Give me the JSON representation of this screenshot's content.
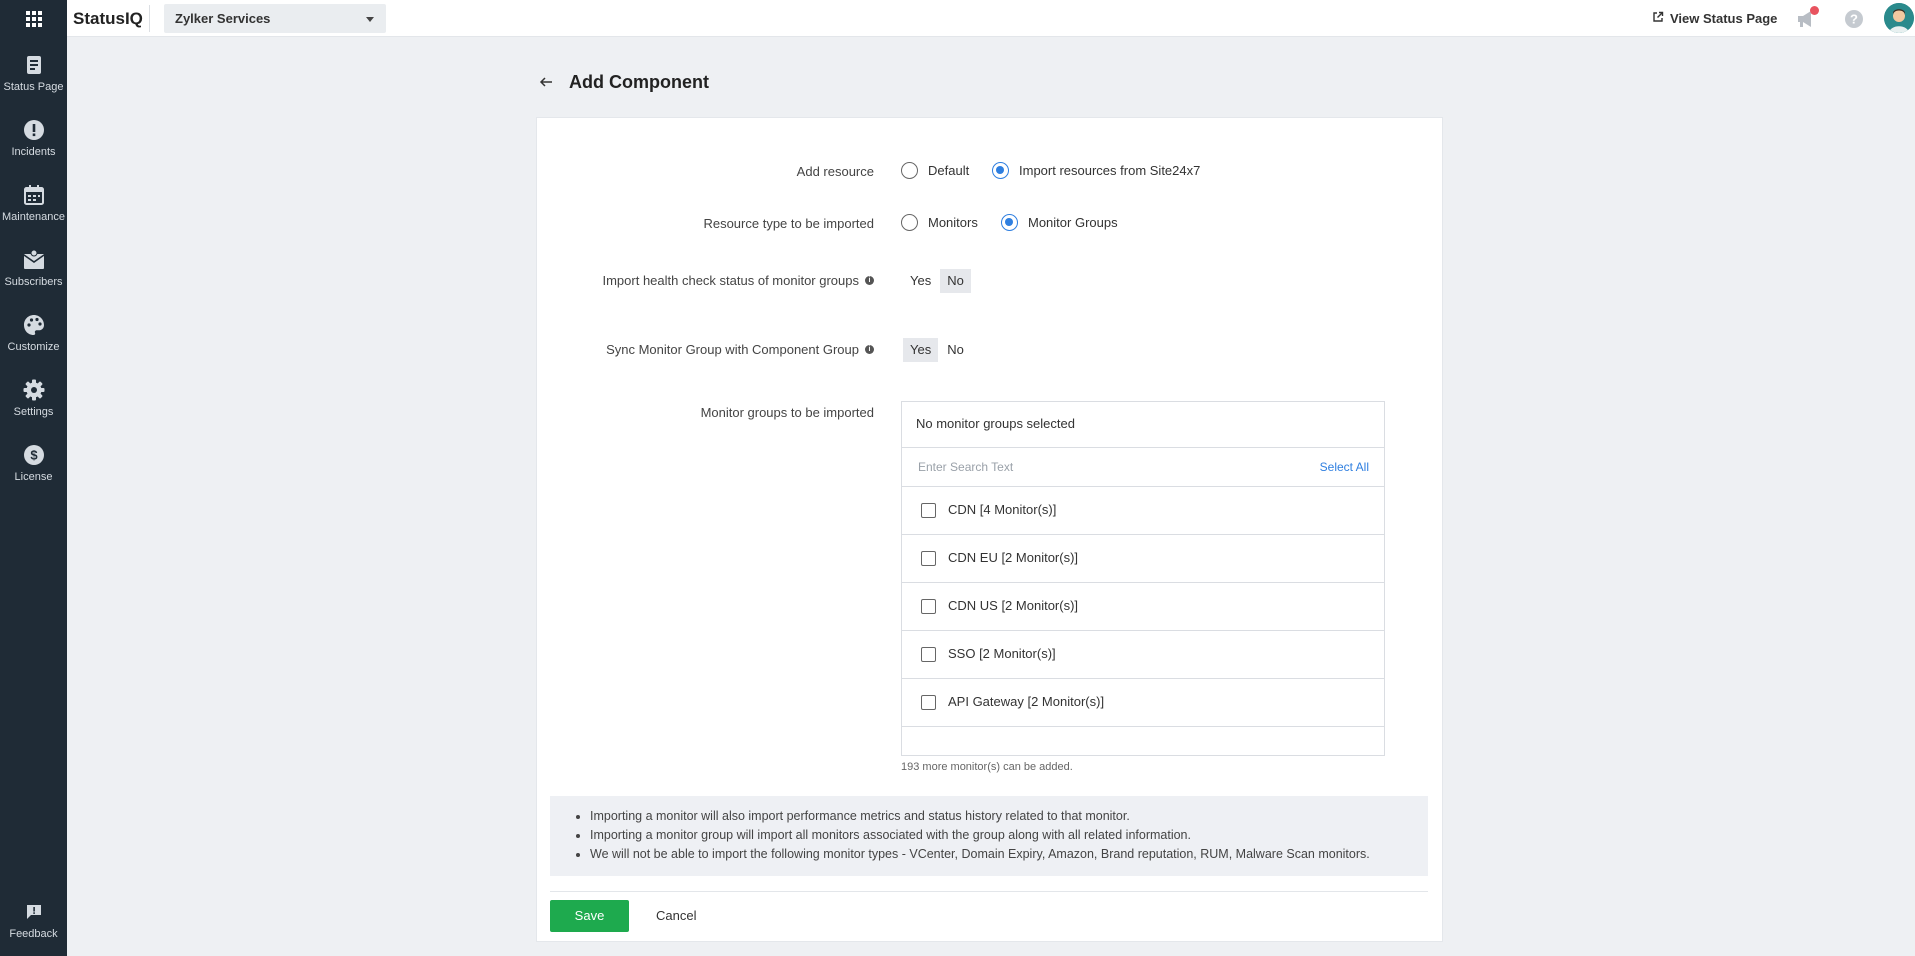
{
  "topbar": {
    "brand": "StatusIQ",
    "org_name": "Zylker Services",
    "view_status_label": "View Status Page"
  },
  "sidebar": {
    "items": [
      {
        "label": "Status Page",
        "icon": "status-page-icon"
      },
      {
        "label": "Incidents",
        "icon": "incidents-icon"
      },
      {
        "label": "Maintenance",
        "icon": "calendar-icon"
      },
      {
        "label": "Subscribers",
        "icon": "subscribers-icon"
      },
      {
        "label": "Customize",
        "icon": "palette-icon"
      },
      {
        "label": "Settings",
        "icon": "gear-icon"
      },
      {
        "label": "License",
        "icon": "dollar-icon"
      }
    ],
    "feedback_label": "Feedback"
  },
  "page": {
    "title": "Add Component"
  },
  "form": {
    "add_resource": {
      "label": "Add resource",
      "options": [
        "Default",
        "Import resources from Site24x7"
      ],
      "selected": "Import resources from Site24x7"
    },
    "resource_type": {
      "label": "Resource type to be imported",
      "options": [
        "Monitors",
        "Monitor Groups"
      ],
      "selected": "Monitor Groups"
    },
    "import_health": {
      "label": "Import health check status of monitor groups",
      "yes": "Yes",
      "no": "No",
      "selected": "No"
    },
    "sync_group": {
      "label": "Sync Monitor Group with Component Group",
      "yes": "Yes",
      "no": "No",
      "selected": "Yes"
    },
    "monitor_groups": {
      "label": "Monitor groups to be imported",
      "header": "No monitor groups selected",
      "search_placeholder": "Enter Search Text",
      "select_all": "Select All",
      "items": [
        "CDN [4 Monitor(s)]",
        "CDN EU [2 Monitor(s)]",
        "CDN US [2 Monitor(s)]",
        "SSO [2 Monitor(s)]",
        "API Gateway [2 Monitor(s)]"
      ],
      "note": "193 more monitor(s) can be added."
    },
    "info": [
      "Importing a monitor will also import performance metrics and status history related to that monitor.",
      "Importing a monitor group will import all monitors associated with the group along with all related information.",
      "We will not be able to import the following monitor types - VCenter, Domain Expiry, Amazon, Brand reputation, RUM, Malware Scan monitors."
    ],
    "save_label": "Save",
    "cancel_label": "Cancel"
  },
  "colors": {
    "sidebar_bg": "#1f2b36",
    "accent": "#2f7fe0",
    "save_green": "#1eaa4e"
  }
}
